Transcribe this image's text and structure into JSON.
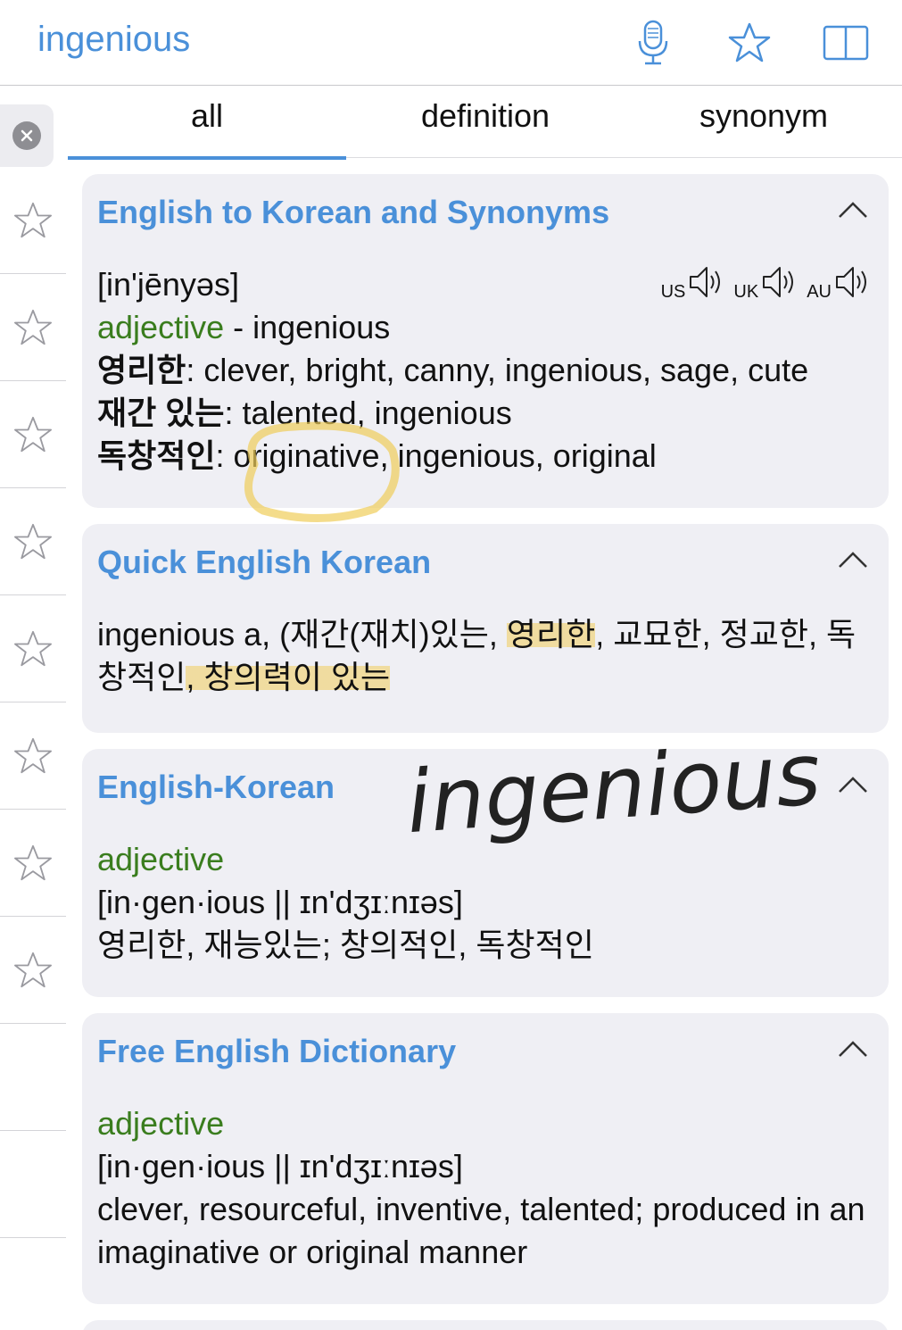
{
  "search": {
    "query": "ingenious"
  },
  "tabs": [
    {
      "label": "all",
      "active": true
    },
    {
      "label": "definition",
      "active": false
    },
    {
      "label": "synonym",
      "active": false
    }
  ],
  "icons": {
    "mic": "microphone-icon",
    "favorite": "star-icon",
    "book": "book-icon",
    "clear": "close-circle-icon",
    "chevron": "chevron-up-icon",
    "speaker": "speaker-icon"
  },
  "colors": {
    "accent": "#4a90d9",
    "pos": "#3a7d1e",
    "card": "#efeff4",
    "highlight": "#f0cd5a",
    "ink": "#222222"
  },
  "cards": {
    "eko": {
      "title": "English to Korean and Synonyms",
      "pronunciation": "[in'jēnyəs]",
      "pos": "adjective",
      "pos_word": " - ingenious",
      "accents": [
        "US",
        "UK",
        "AU"
      ],
      "rows": [
        {
          "ko": "영리한",
          "en": ": clever, bright, canny, ingenious, sage, cute"
        },
        {
          "ko": "재간 있는",
          "en": ": talented, ingenious"
        },
        {
          "ko": "독창적인",
          "en": ": originative, ingenious, original"
        }
      ]
    },
    "quick": {
      "title": "Quick English Korean",
      "text_a": "ingenious a, (재간(재치)있는, ",
      "text_hl1": "영리한",
      "text_b": ", 교묘한, 정교한, 독창적인",
      "text_hl2": ", 창의력이 있는"
    },
    "ek": {
      "title": "English-Korean",
      "pos": "adjective",
      "pron": "[in·gen·ious || ɪn'dʒɪːnɪəs]",
      "meaning": "영리한, 재능있는; 창의적인, 독창적인"
    },
    "free": {
      "title": "Free English Dictionary",
      "pos": "adjective",
      "pron": "[in·gen·ious || ɪn'dʒɪːnɪəs]",
      "meaning": "clever, resourceful, inventive, talented; produced in an imaginative or original manner"
    }
  },
  "annotation": {
    "handwriting": "ingenious"
  }
}
